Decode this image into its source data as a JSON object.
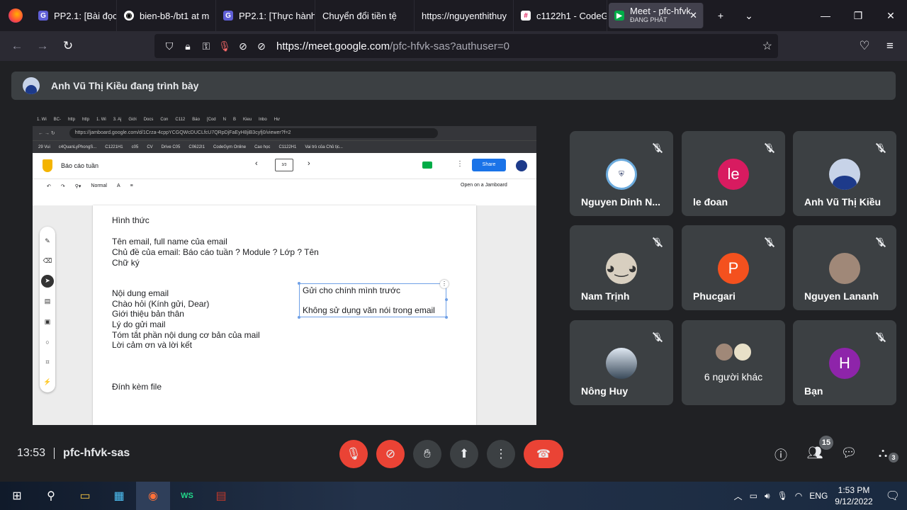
{
  "browser": {
    "tabs": [
      {
        "label": "PP2.1: [Bài đọc] Sử",
        "fav_color": "#5f5fd6",
        "fav": "G"
      },
      {
        "label": "bien-b8-/bt1 at m",
        "fav_color": "#ffffff",
        "fav": "◉"
      },
      {
        "label": "PP2.1: [Thực hành",
        "fav_color": "#5f5fd6",
        "fav": "G"
      },
      {
        "label": "Chuyển đổi tiền tệ",
        "fav_color": "",
        "fav": ""
      },
      {
        "label": "https://nguyenthithuy",
        "fav_color": "",
        "fav": ""
      },
      {
        "label": "c1122h1 - CodeGy",
        "fav_color": "#e01e5a",
        "fav": "#"
      }
    ],
    "active_tab": {
      "label": "Meet - pfc-hfvk",
      "sub": "ĐANG PHÁT"
    },
    "url_host": "https://meet.google.com",
    "url_path": "/pfc-hfvk-sas?authuser=0"
  },
  "presenter_bar": {
    "text": "Anh Vũ Thị Kiều đang trình bày"
  },
  "shared": {
    "tabs": [
      "1. Wi",
      "BC-",
      "http",
      "http",
      "1. Wi",
      "3. Aj",
      "Giới",
      "Docs",
      "Con",
      "C112",
      "Báo",
      "[Cod",
      "N",
      "B",
      "Kieu",
      "Inbo",
      "Hư"
    ],
    "url": "https://jamboard.google.com/d/1Crza-4cppYCGQWcDUCLfcU7QRpDjFaEyH8jiB3cyfj0/viewer?f=2",
    "bookmarks": [
      "29 Vui",
      "c4QuanLyPhongS...",
      "C1221H1",
      "c05",
      "CV",
      "Drive C05",
      "C0622I1",
      "CodeGym Online",
      "Cao học",
      "C1122H1",
      "Vai trò của Chủ tịc..."
    ],
    "doc_title": "Báo cáo tuần",
    "frame_label": "3/3",
    "share_label": "Share",
    "toolbar": {
      "style": "Normal",
      "open": "Open on a Jamboard"
    },
    "lines": {
      "l1": "Hình thức",
      "l2": "Tên email, full name của email",
      "l3": "Chủ đề của email: Báo cáo tuần ? Module ? Lớp ? Tên",
      "l4": "Chữ ký",
      "l5": "Nội dung email",
      "l6": "Chào hỏi (Kính gửi, Dear)",
      "l7": "Giới thiệu bản thân",
      "l8": "Lý do gửi mail",
      "l9": "Tóm tắt phần nội dung cơ bản của mail",
      "l10": "Lời cảm ơn và lời kết",
      "l11": "Đính kèm file"
    },
    "textbox": {
      "line1": "Gửi cho chính mình trước",
      "line2": "Không sử dụng văn nói trong email"
    }
  },
  "participants": [
    {
      "name": "Nguyen Dinh N...",
      "avatar": "",
      "color": "#ffffff"
    },
    {
      "name": "le đoan",
      "avatar": "le",
      "color": "#d81b60"
    },
    {
      "name": "Anh Vũ Thị Kiều",
      "avatar": "",
      "color": "#c7d3e8"
    },
    {
      "name": "Nam Trịnh",
      "avatar": "",
      "color": "#d8cfc0"
    },
    {
      "name": "Phucgari",
      "avatar": "P",
      "color": "#f4511e"
    },
    {
      "name": "Nguyen Lananh",
      "avatar": "",
      "color": "#a08878"
    },
    {
      "name": "Nông Huy",
      "avatar": "",
      "color": "#8aa0b8"
    },
    {
      "name": "6 người khác",
      "avatar": "",
      "color": ""
    },
    {
      "name": "Bạn",
      "avatar": "H",
      "color": "#8e24aa"
    }
  ],
  "meeting": {
    "time": "13:53",
    "code": "pfc-hfvk-sas",
    "people_count": "15",
    "activity_count": "3"
  },
  "taskbar": {
    "time": "1:53 PM",
    "date": "9/12/2022",
    "lang": "ENG"
  }
}
